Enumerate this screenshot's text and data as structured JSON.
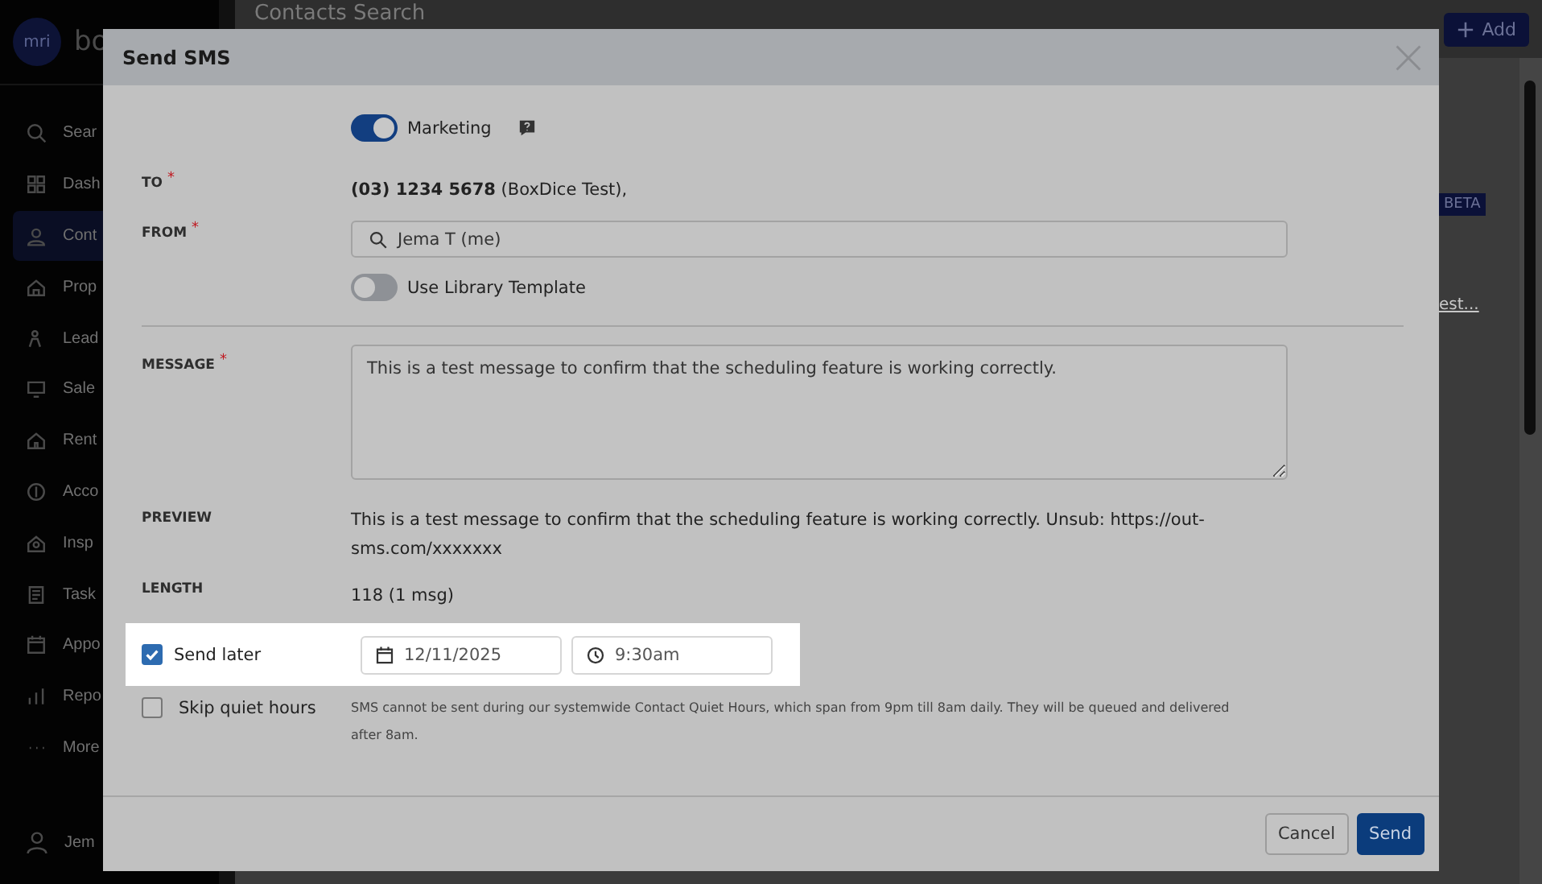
{
  "sidebar": {
    "logo_text": "mri",
    "brand": "bo",
    "items": [
      {
        "label": "Sear",
        "selected": false
      },
      {
        "label": "Dash",
        "selected": false
      },
      {
        "label": "Cont",
        "selected": true
      },
      {
        "label": "Prop",
        "selected": false
      },
      {
        "label": "Lead",
        "selected": false
      },
      {
        "label": "Sale",
        "selected": false
      },
      {
        "label": "Rent",
        "selected": false
      },
      {
        "label": "Acco",
        "selected": false
      },
      {
        "label": "Insp",
        "selected": false
      },
      {
        "label": "Task",
        "selected": false
      },
      {
        "label": "Appo",
        "selected": false
      },
      {
        "label": "Repo",
        "selected": false
      },
      {
        "label": "More",
        "selected": false
      }
    ],
    "user": "Jem"
  },
  "page": {
    "title": "Contacts Search",
    "add_button": "Add",
    "beta_badge": "BETA",
    "link": "est..."
  },
  "dialog": {
    "title": "Send SMS",
    "marketing": {
      "label": "Marketing",
      "on": true
    },
    "to": {
      "label": "TO",
      "required_mark": "*",
      "value": "**(03) 1234 5678** (BoxDice Test),"
    },
    "from": {
      "label": "FROM",
      "required_mark": "*",
      "value": "Jema T (me)"
    },
    "library_template": {
      "label": "Use Library Template",
      "on": false
    },
    "message": {
      "label": "MESSAGE",
      "required_mark": "*",
      "value": "This is a test message to confirm that the scheduling feature is working correctly."
    },
    "preview": {
      "label": "PREVIEW",
      "value": "This is a test message to confirm that the scheduling feature is working correctly. Unsub: https://out-sms.com/xxxxxxx"
    },
    "length": {
      "label": "LENGTH",
      "value": "118 (1 msg)"
    },
    "send_later": {
      "label": "Send later",
      "checked": true,
      "date": "12/11/2025",
      "time": "9:30am"
    },
    "skip_quiet_hours": {
      "label": "Skip quiet hours",
      "checked": false,
      "note": "SMS cannot be sent during our systemwide Contact Quiet Hours, which span from 9pm till 8am daily. They will be queued and delivered after 8am."
    },
    "buttons": [
      {
        "label": "Cancel",
        "kind": "secondary"
      },
      {
        "label": "Send",
        "kind": "primary"
      }
    ]
  }
}
